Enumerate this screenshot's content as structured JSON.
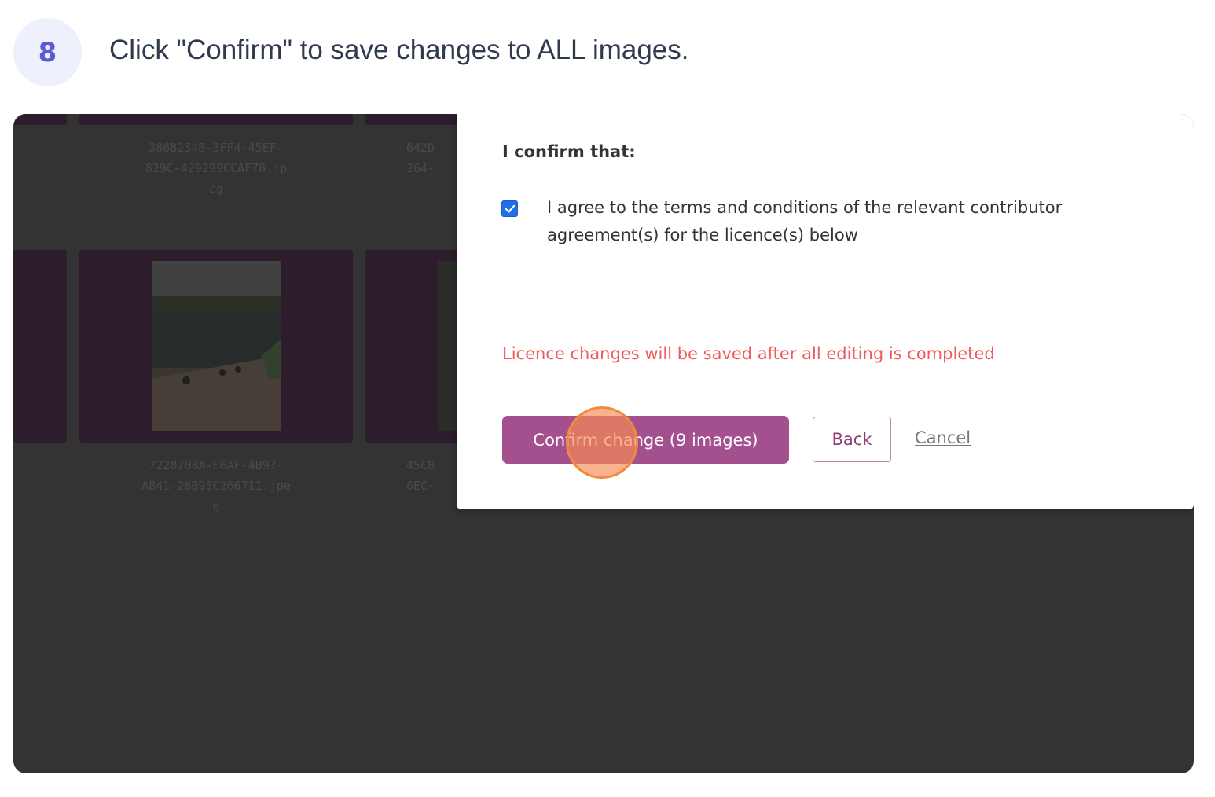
{
  "step": {
    "number": "8",
    "instruction": "Click \"Confirm\" to save changes to ALL images."
  },
  "background_grid": {
    "filenames": [
      "386B234B-3FF4-45EF-\n829C-429299CCAF78.jp\neg",
      "642D\n264-",
      "7228708A-F6AF-4B97-\nAB41-28B93C266711.jpe\ng",
      "45C8\n6EC-"
    ]
  },
  "modal": {
    "heading": "I confirm that:",
    "checkbox_checked": true,
    "agreement_text": "I agree to the terms and conditions of the relevant contributor agreement(s) for the licence(s) below",
    "warning": "Licence changes will be saved after all editing is completed",
    "confirm_button": "Confirm change (9 images)",
    "back_button": "Back",
    "cancel_link": "Cancel"
  },
  "colors": {
    "accent": "#a4508f",
    "warning": "#ef5b5b",
    "checkbox": "#1f6fe5",
    "step_badge_bg": "#eef0fc",
    "step_badge_text": "#5b5bd6",
    "overlay": "#333333",
    "click_marker": "#f08a3e"
  }
}
